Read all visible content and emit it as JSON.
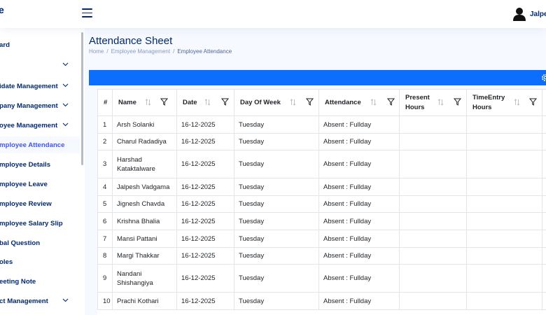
{
  "header": {
    "logo_fragment": "e",
    "user_name": "Jalpes"
  },
  "sidebar": {
    "items": [
      {
        "label": "ard",
        "chevron": false,
        "active": false
      },
      {
        "label": "",
        "chevron": true,
        "active": false
      },
      {
        "label": "idate Management",
        "chevron": true,
        "active": false
      },
      {
        "label": "pany Management",
        "chevron": true,
        "active": false
      },
      {
        "label": "oyee Management",
        "chevron": true,
        "active": false
      },
      {
        "label": "mployee Attendance",
        "chevron": false,
        "active": true
      },
      {
        "label": "mployee Details",
        "chevron": false,
        "active": false
      },
      {
        "label": "mployee Leave",
        "chevron": false,
        "active": false
      },
      {
        "label": "mployee Review",
        "chevron": false,
        "active": false
      },
      {
        "label": "mployee Salary Slip",
        "chevron": false,
        "active": false
      },
      {
        "label": "bal Question",
        "chevron": false,
        "active": false
      },
      {
        "label": "oles",
        "chevron": false,
        "active": false
      },
      {
        "label": "eeting Note",
        "chevron": false,
        "active": false
      },
      {
        "label": "ct Management",
        "chevron": true,
        "active": false
      }
    ]
  },
  "page": {
    "title": "Attendance Sheet",
    "breadcrumb": [
      "Home",
      "Employee Management",
      "Employee Attendance"
    ]
  },
  "table": {
    "columns": [
      {
        "label": "#",
        "sortable": false,
        "filter": false
      },
      {
        "label": "Name",
        "sortable": true,
        "filter": true
      },
      {
        "label": "Date",
        "sortable": true,
        "filter": true
      },
      {
        "label": "Day Of Week",
        "sortable": true,
        "filter": true
      },
      {
        "label": "Attendance",
        "sortable": true,
        "filter": true
      },
      {
        "label": "Present Hours",
        "sortable": true,
        "filter": true
      },
      {
        "label": "TimeEntry Hours",
        "sortable": true,
        "filter": true
      },
      {
        "label": "",
        "sortable": false,
        "filter": false
      }
    ],
    "rows": [
      {
        "num": "1",
        "name": "Arsh Solanki",
        "date": "16-12-2025",
        "day": "Tuesday",
        "attendance": "Absent : Fullday",
        "present": "",
        "timeentry": ""
      },
      {
        "num": "2",
        "name": "Charul Radadiya",
        "date": "16-12-2025",
        "day": "Tuesday",
        "attendance": "Absent : Fullday",
        "present": "",
        "timeentry": ""
      },
      {
        "num": "3",
        "name": "Harshad Kataktalware",
        "date": "16-12-2025",
        "day": "Tuesday",
        "attendance": "Absent : Fullday",
        "present": "",
        "timeentry": ""
      },
      {
        "num": "4",
        "name": "Jalpesh Vadgama",
        "date": "16-12-2025",
        "day": "Tuesday",
        "attendance": "Absent : Fullday",
        "present": "",
        "timeentry": ""
      },
      {
        "num": "5",
        "name": "Jignesh Chavda",
        "date": "16-12-2025",
        "day": "Tuesday",
        "attendance": "Absent : Fullday",
        "present": "",
        "timeentry": ""
      },
      {
        "num": "6",
        "name": "Krishna Bhalia",
        "date": "16-12-2025",
        "day": "Tuesday",
        "attendance": "Absent : Fullday",
        "present": "",
        "timeentry": ""
      },
      {
        "num": "7",
        "name": "Mansi Pattani",
        "date": "16-12-2025",
        "day": "Tuesday",
        "attendance": "Absent : Fullday",
        "present": "",
        "timeentry": ""
      },
      {
        "num": "8",
        "name": "Margi Thakkar",
        "date": "16-12-2025",
        "day": "Tuesday",
        "attendance": "Absent : Fullday",
        "present": "",
        "timeentry": ""
      },
      {
        "num": "9",
        "name": "Nandani Shishangiya",
        "date": "16-12-2025",
        "day": "Tuesday",
        "attendance": "Absent : Fullday",
        "present": "",
        "timeentry": ""
      },
      {
        "num": "10",
        "name": "Prachi Kothari",
        "date": "16-12-2025",
        "day": "Tuesday",
        "attendance": "Absent : Fullday",
        "present": "",
        "timeentry": ""
      }
    ]
  },
  "colors": {
    "primary_text": "#012970",
    "toolbar_blue": "#0d6efd",
    "active_link": "#4154f1",
    "page_bg": "#f6f9ff"
  },
  "icons": {
    "menu": "hamburger-icon",
    "user": "user-avatar-icon",
    "chevron": "chevron-down-icon",
    "sort": "sort-arrows-icon",
    "filter": "filter-funnel-icon",
    "settings": "gear-icon"
  }
}
